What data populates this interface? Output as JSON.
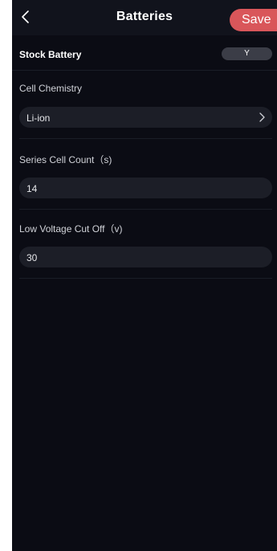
{
  "header": {
    "title": "Batteries",
    "save_label": "Save",
    "back_icon": "chevron-left-icon"
  },
  "stock_battery": {
    "label": "Stock Battery",
    "value": "Y"
  },
  "fields": {
    "cell_chemistry": {
      "label": "Cell Chemistry",
      "value": "Li-ion",
      "icon": "chevron-right-icon"
    },
    "series_cell_count": {
      "label": "Series Cell Count（s)",
      "value": "14"
    },
    "low_voltage_cut_off": {
      "label": "Low Voltage Cut Off（v)",
      "value": "30"
    }
  },
  "colors": {
    "background": "#0b0c14",
    "header": "#11131c",
    "accent": "#d9565a",
    "field": "#1c1e27",
    "toggle": "#3b3d47"
  }
}
